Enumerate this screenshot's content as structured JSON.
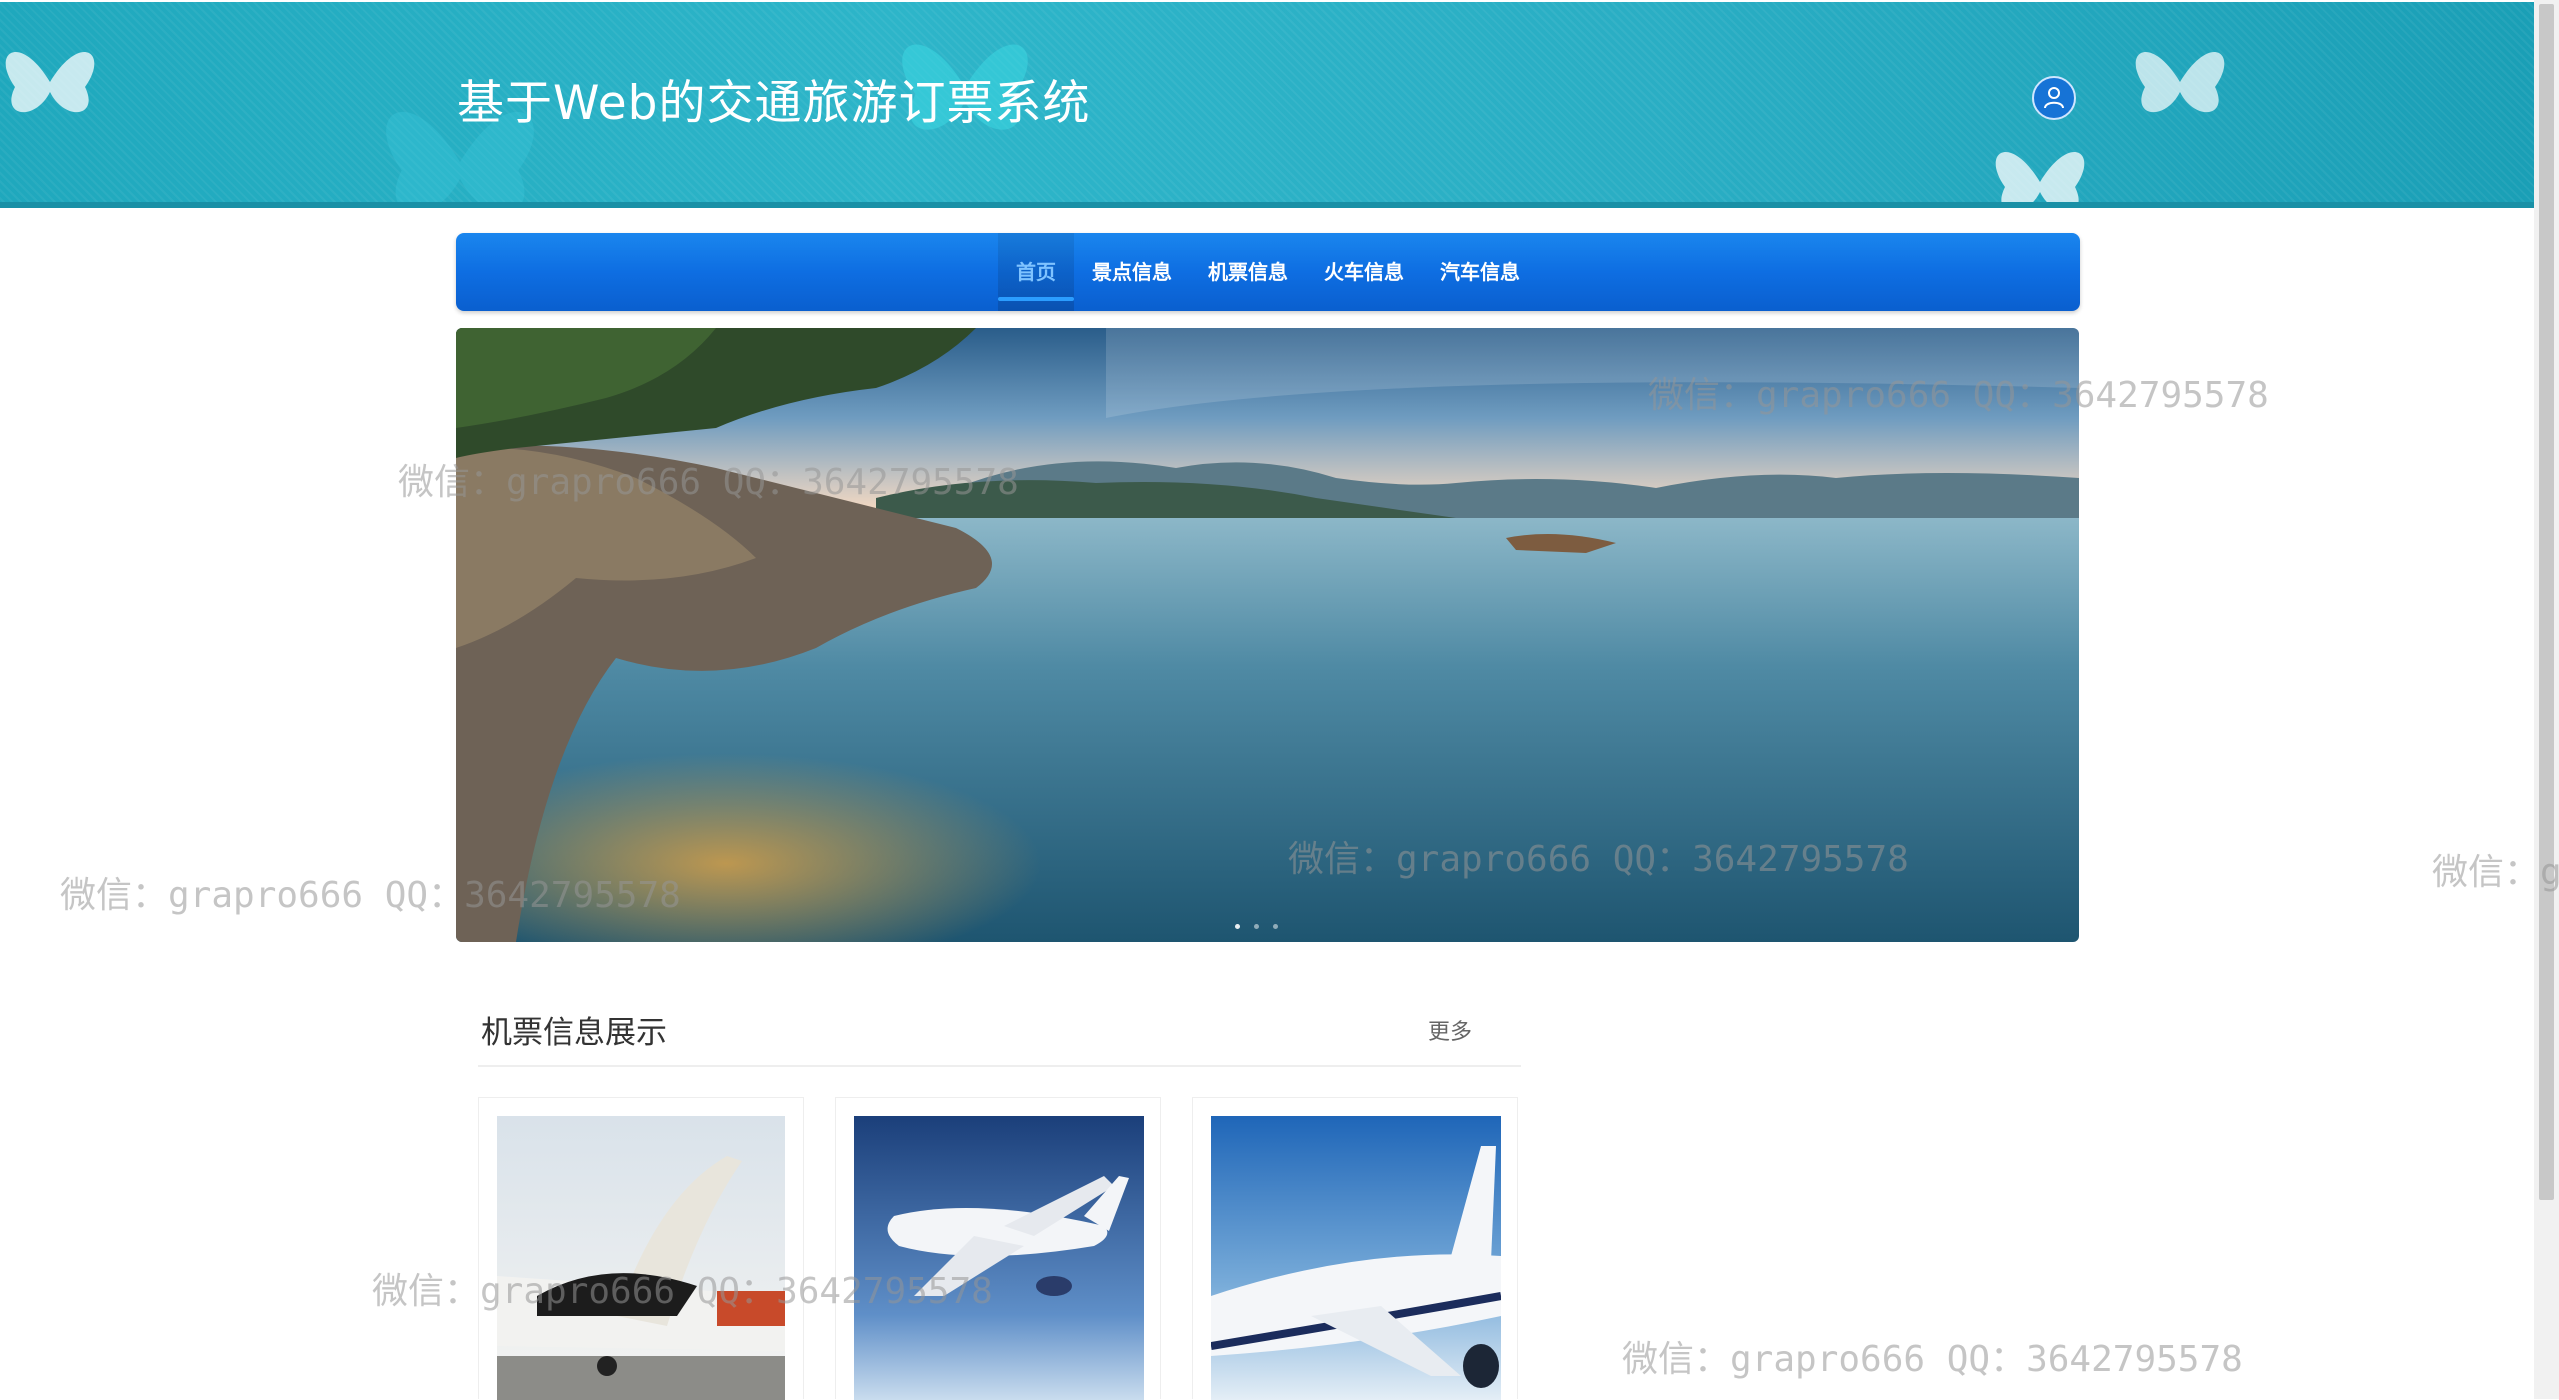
{
  "header": {
    "title": "基于Web的交通旅游订票系统",
    "user_icon": "user-icon"
  },
  "nav": {
    "items": [
      {
        "label": "首页",
        "active": true
      },
      {
        "label": "景点信息",
        "active": false
      },
      {
        "label": "机票信息",
        "active": false
      },
      {
        "label": "火车信息",
        "active": false
      },
      {
        "label": "汽车信息",
        "active": false
      }
    ]
  },
  "banner": {
    "image": "lake-landscape",
    "slides": 3
  },
  "section": {
    "title": "机票信息展示",
    "more": "更多",
    "cards": [
      {
        "image": "airplane-tail-on-tarmac"
      },
      {
        "image": "airplane-in-flight-front"
      },
      {
        "image": "airplane-in-flight-side"
      }
    ]
  },
  "watermark": {
    "text": "微信：grapro666 QQ：3642795578",
    "text_cut": "微信：g"
  },
  "colors": {
    "header": "#2aaec4",
    "nav": "#0e6ee2",
    "active_nav": "#7fc3ff"
  }
}
